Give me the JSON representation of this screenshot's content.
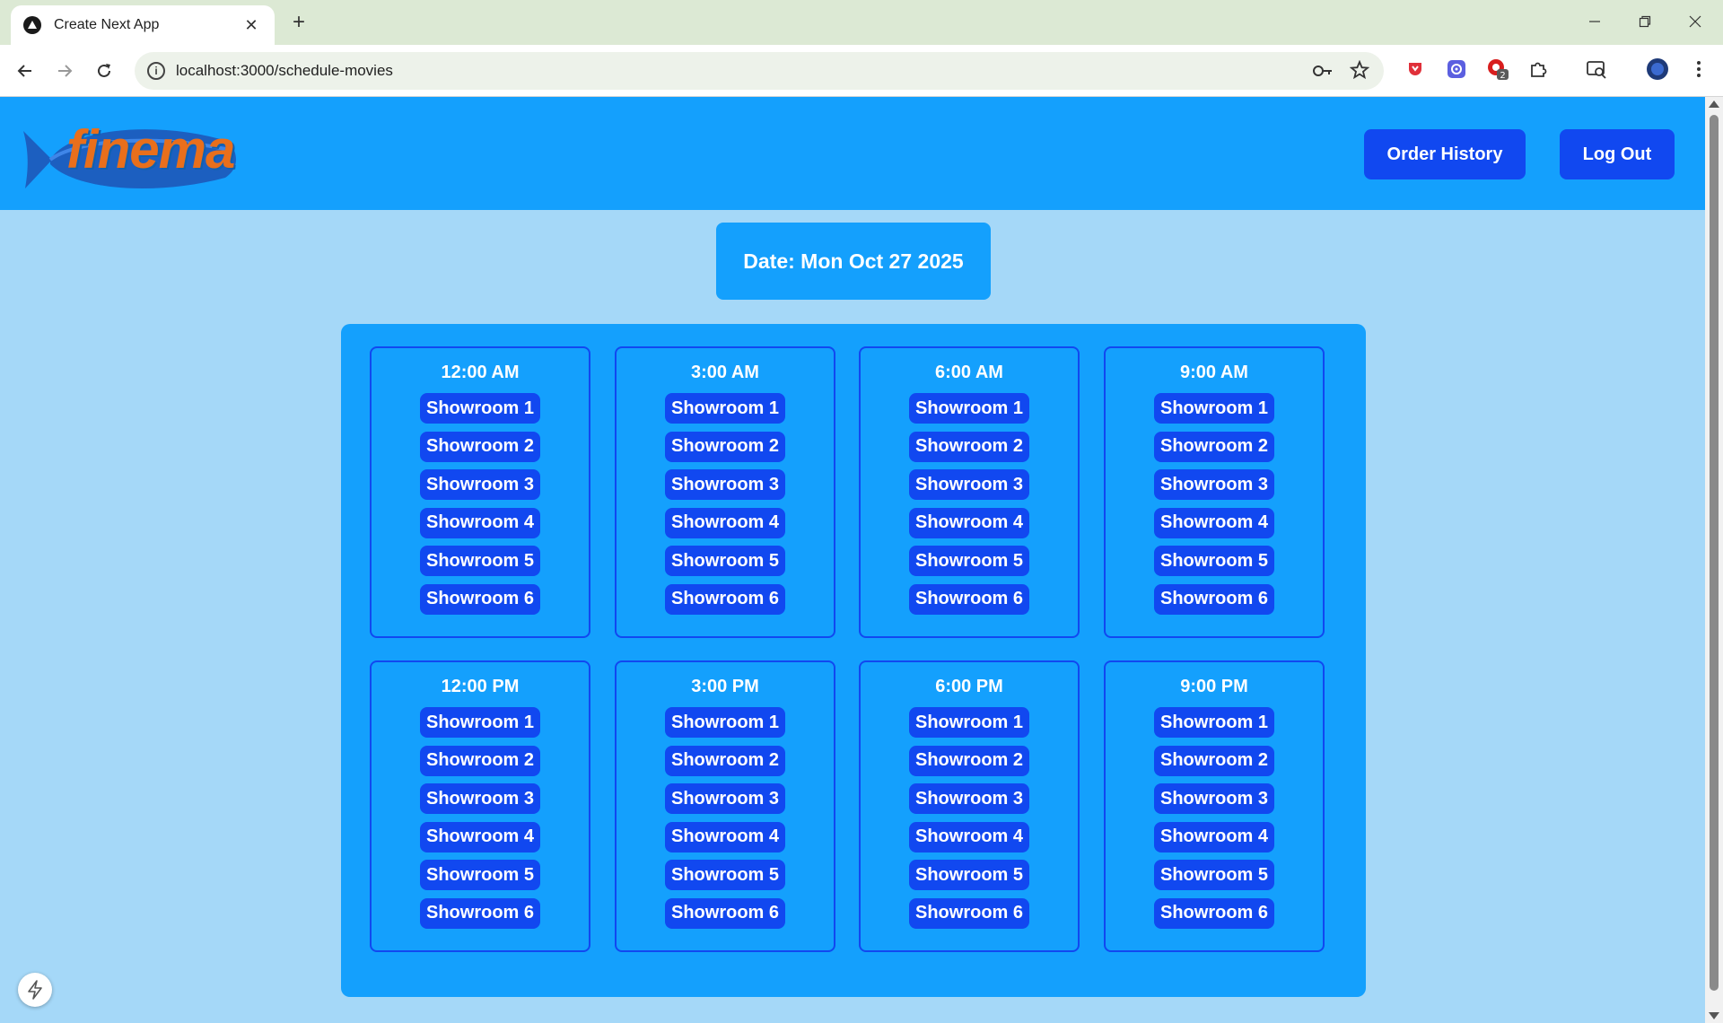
{
  "browser": {
    "tab_title": "Create Next App",
    "url": "localhost:3000/schedule-movies",
    "extension_badge": "2"
  },
  "header": {
    "logo_text": "finema",
    "order_history_label": "Order History",
    "logout_label": "Log Out"
  },
  "date_label": "Date: Mon Oct 27 2025",
  "time_slots": [
    {
      "time": "12:00 AM",
      "rooms": [
        "Showroom 1",
        "Showroom 2",
        "Showroom 3",
        "Showroom 4",
        "Showroom 5",
        "Showroom 6"
      ]
    },
    {
      "time": "3:00 AM",
      "rooms": [
        "Showroom 1",
        "Showroom 2",
        "Showroom 3",
        "Showroom 4",
        "Showroom 5",
        "Showroom 6"
      ]
    },
    {
      "time": "6:00 AM",
      "rooms": [
        "Showroom 1",
        "Showroom 2",
        "Showroom 3",
        "Showroom 4",
        "Showroom 5",
        "Showroom 6"
      ]
    },
    {
      "time": "9:00 AM",
      "rooms": [
        "Showroom 1",
        "Showroom 2",
        "Showroom 3",
        "Showroom 4",
        "Showroom 5",
        "Showroom 6"
      ]
    },
    {
      "time": "12:00 PM",
      "rooms": [
        "Showroom 1",
        "Showroom 2",
        "Showroom 3",
        "Showroom 4",
        "Showroom 5",
        "Showroom 6"
      ]
    },
    {
      "time": "3:00 PM",
      "rooms": [
        "Showroom 1",
        "Showroom 2",
        "Showroom 3",
        "Showroom 4",
        "Showroom 5",
        "Showroom 6"
      ]
    },
    {
      "time": "6:00 PM",
      "rooms": [
        "Showroom 1",
        "Showroom 2",
        "Showroom 3",
        "Showroom 4",
        "Showroom 5",
        "Showroom 6"
      ]
    },
    {
      "time": "9:00 PM",
      "rooms": [
        "Showroom 1",
        "Showroom 2",
        "Showroom 3",
        "Showroom 4",
        "Showroom 5",
        "Showroom 6"
      ]
    }
  ],
  "colors": {
    "page_background": "#a5d8f8",
    "header_background": "#14a0fd",
    "button_blue": "#1148f0",
    "logo_orange": "#e86f1c"
  },
  "icons": {
    "tab_favicon": "nextjs-triangle-icon",
    "extensions": [
      "shield-extension-icon",
      "gear-extension-icon",
      "blocker-extension-icon",
      "puzzle-icon",
      "tab-search-icon",
      "profile-avatar-icon",
      "more-menu-icon"
    ]
  }
}
